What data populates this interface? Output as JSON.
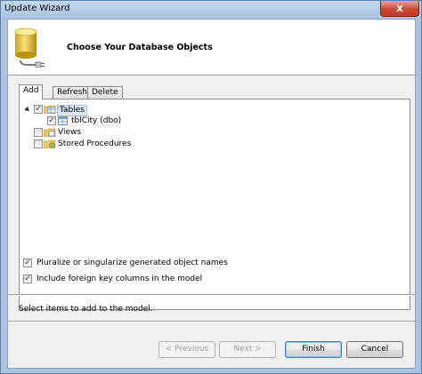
{
  "window": {
    "title": "Update Wizard",
    "close_glyph": "x"
  },
  "header": {
    "title": "Choose Your Database Objects",
    "icon": "database-connect-icon"
  },
  "tabs": [
    {
      "label": "Add",
      "active": true
    },
    {
      "label": "Refresh",
      "active": false
    },
    {
      "label": "Delete",
      "active": false
    }
  ],
  "tree": {
    "items": [
      {
        "label": "Tables",
        "checked": true,
        "expanded": true,
        "level": 0,
        "selected": true
      },
      {
        "label": "tblCity (dbo)",
        "checked": true,
        "level": 1
      },
      {
        "label": "Views",
        "checked": false,
        "level": 0
      },
      {
        "label": "Stored Procedures",
        "checked": false,
        "level": 0
      }
    ]
  },
  "options": [
    {
      "label": "Pluralize or singularize generated object names",
      "checked": true
    },
    {
      "label": "Include foreign key columns in the model",
      "checked": true
    }
  ],
  "status_text": "Select items to add to the model.",
  "buttons": {
    "previous": "< Previous",
    "next": "Next >",
    "finish": "Finish",
    "cancel": "Cancel"
  },
  "colors": {
    "frame": "#aac4e0",
    "close_button": "#c74b33",
    "default_button_border": "#3c7fb1"
  }
}
